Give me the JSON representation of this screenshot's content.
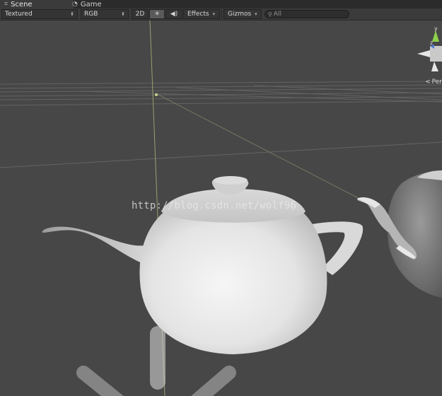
{
  "tabs": [
    {
      "label": "Scene",
      "icon": "hash-grid-icon",
      "active": true
    },
    {
      "label": "Game",
      "icon": "pacman-icon",
      "active": false
    }
  ],
  "toolbar": {
    "draw_mode": "Textured",
    "render_mode": "RGB",
    "btn_2d": "2D",
    "lighting_icon": "sun-icon",
    "audio_icon": "speaker-icon",
    "effects": "Effects",
    "gizmos": "Gizmos",
    "search_placeholder": "All"
  },
  "viewport": {
    "watermark": "http://blog.csdn.net/wolf96",
    "orientation_gizmo": {
      "axis_y": "y",
      "axis_z": "z",
      "projection": "Per"
    }
  },
  "colors": {
    "tabbar": "#2b2b2b",
    "toolbar": "#3b3b3b",
    "viewport_bg": "#474747",
    "grid": "#6a6a6a",
    "axis_y": "#c3d48a",
    "gizmo_y": "#8ed04b",
    "gizmo_z": "#4b7ad0",
    "gizmo_x": "#d04b4b"
  }
}
